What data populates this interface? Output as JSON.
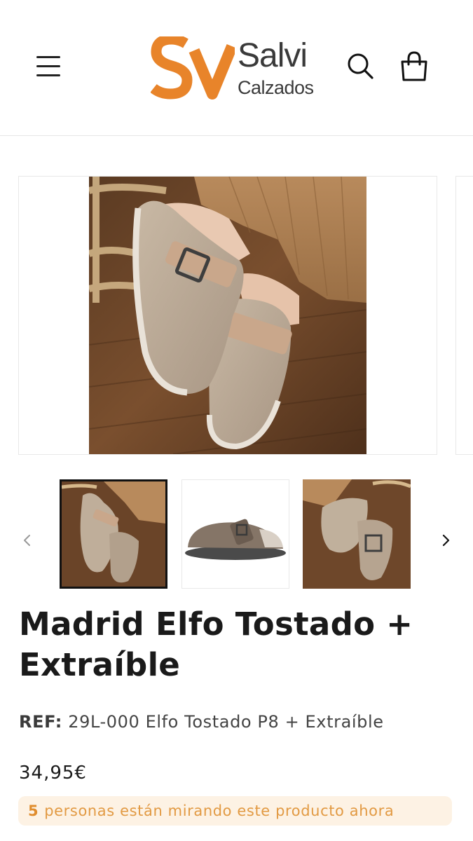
{
  "header": {
    "brand_name": "Salvi",
    "brand_sub": "Calzados",
    "brand_color": "#E8842A",
    "icons": [
      "menu-icon",
      "search-icon",
      "shopping-bag-icon"
    ]
  },
  "gallery": {
    "thumbnails": [
      "thumbnail-1",
      "thumbnail-2",
      "thumbnail-3"
    ],
    "active_index": 0,
    "prev_icon": "chevron-left-icon",
    "next_icon": "chevron-right-icon"
  },
  "product": {
    "title": "Madrid Elfo Tostado + Extraíble",
    "ref_label": "REF:",
    "ref_value": "29L-000 Elfo Tostado P8 + Extraíble",
    "price": "34,95€"
  },
  "viewers": {
    "count": "5",
    "text": "personas están mirando este producto ahora",
    "accent": "#E08D2E"
  }
}
